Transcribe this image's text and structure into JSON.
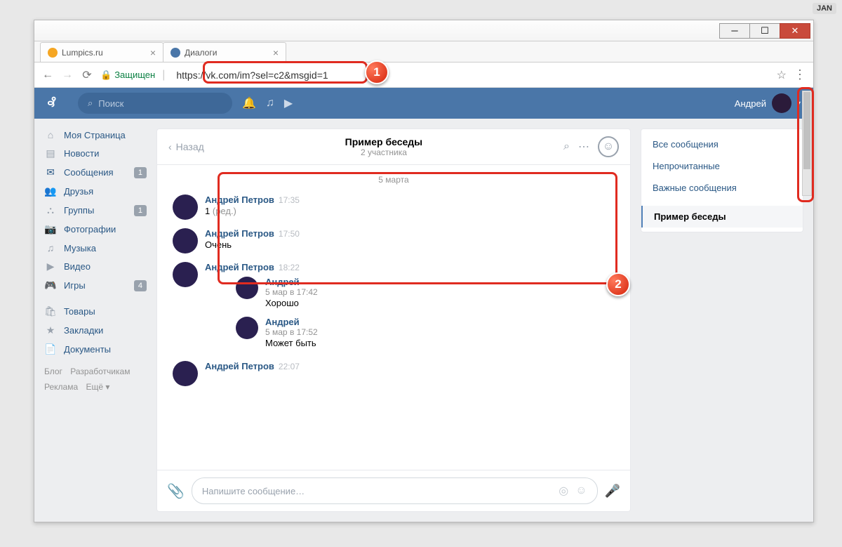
{
  "wayback_label": "JAN",
  "browser": {
    "tabs": [
      {
        "title": "Lumpics.ru",
        "favicon_color": "#f5a623"
      },
      {
        "title": "Диалоги",
        "favicon_color": "#4a76a8"
      }
    ],
    "secure_label": "Защищен",
    "url": "https://vk.com/im?sel=c2&msgid=1"
  },
  "header": {
    "search_placeholder": "Поиск",
    "user_name": "Андрей"
  },
  "left_nav": {
    "items": [
      {
        "icon": "⌂",
        "label": "Моя Страница",
        "badge": null
      },
      {
        "icon": "▤",
        "label": "Новости",
        "badge": null
      },
      {
        "icon": "✉",
        "label": "Сообщения",
        "badge": "1"
      },
      {
        "icon": "👥",
        "label": "Друзья",
        "badge": null
      },
      {
        "icon": "⛬",
        "label": "Группы",
        "badge": "1"
      },
      {
        "icon": "📷",
        "label": "Фотографии",
        "badge": null
      },
      {
        "icon": "♫",
        "label": "Музыка",
        "badge": null
      },
      {
        "icon": "▶",
        "label": "Видео",
        "badge": null
      },
      {
        "icon": "🎮",
        "label": "Игры",
        "badge": "4"
      }
    ],
    "items2": [
      {
        "icon": "🛍",
        "label": "Товары"
      },
      {
        "icon": "★",
        "label": "Закладки"
      },
      {
        "icon": "📄",
        "label": "Документы"
      }
    ],
    "footer": [
      "Блог",
      "Разработчикам",
      "Реклама",
      "Ещё ▾"
    ]
  },
  "chat": {
    "back_label": "Назад",
    "title": "Пример беседы",
    "subtitle": "2 участника",
    "date_divider": "5 марта",
    "messages": [
      {
        "from": "Андрей Петров",
        "time": "17:35",
        "text": "1",
        "edited": "(ред.)"
      },
      {
        "from": "Андрей Петров",
        "time": "17:50",
        "text": "Очень"
      },
      {
        "from": "Андрей Петров",
        "time": "18:22",
        "text": "",
        "nested": [
          {
            "from": "Андрей",
            "meta": "5 мар в 17:42",
            "text": "Хорошо"
          },
          {
            "from": "Андрей",
            "meta": "5 мар в 17:52",
            "text": "Может быть"
          }
        ]
      },
      {
        "from": "Андрей Петров",
        "time": "22:07",
        "text": ""
      }
    ],
    "composer_placeholder": "Напишите сообщение…"
  },
  "right_panel": {
    "items": [
      {
        "label": "Все сообщения",
        "active": false
      },
      {
        "label": "Непрочитанные",
        "active": false
      },
      {
        "label": "Важные сообщения",
        "active": false
      },
      {
        "label": "Пример беседы",
        "active": true
      }
    ]
  },
  "markers": {
    "one": "1",
    "two": "2"
  }
}
